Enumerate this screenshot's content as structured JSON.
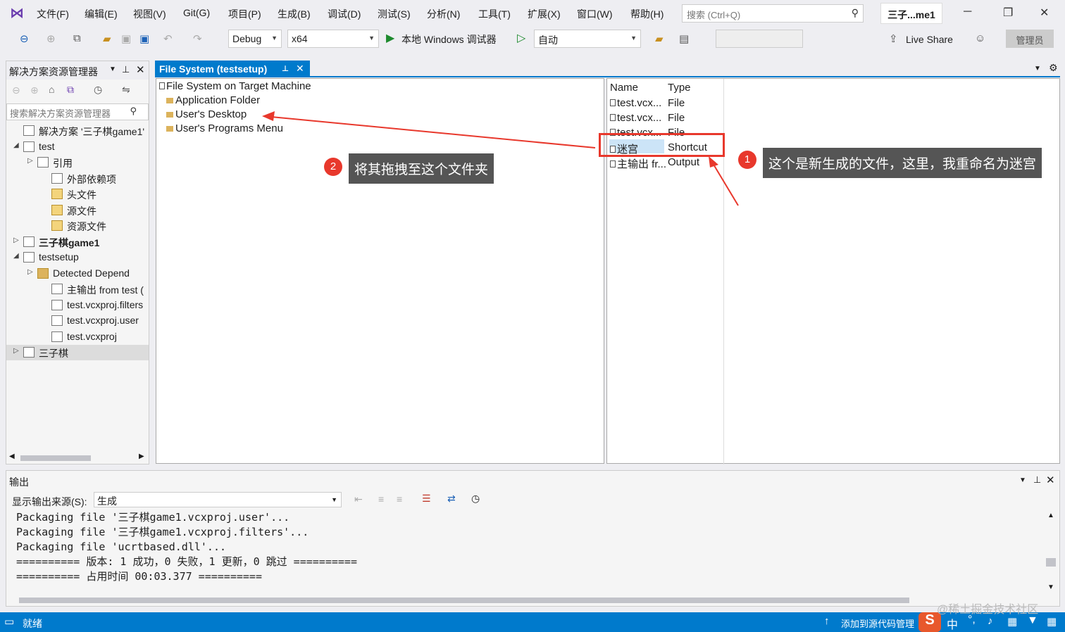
{
  "menubar": {
    "items": [
      "文件(F)",
      "编辑(E)",
      "视图(V)",
      "Git(G)",
      "项目(P)",
      "生成(B)",
      "调试(D)",
      "测试(S)",
      "分析(N)",
      "工具(T)",
      "扩展(X)",
      "窗口(W)",
      "帮助(H)"
    ],
    "search_placeholder": "搜索 (Ctrl+Q)",
    "window_title": "三子...me1"
  },
  "toolbar": {
    "config": "Debug",
    "platform": "x64",
    "debugger": "本地 Windows 调试器",
    "startup": "自动",
    "live_share": "Live Share",
    "admin": "管理员"
  },
  "solution_explorer": {
    "title": "解决方案资源管理器",
    "search_placeholder": "搜索解决方案资源管理器",
    "items": [
      {
        "label": "解决方案 '三子棋game1'",
        "icon": "solution-icon",
        "expander": ""
      },
      {
        "label": "test",
        "icon": "cpp-project-icon",
        "expander": "◢"
      },
      {
        "label": "引用",
        "icon": "references-icon",
        "expander": "▷"
      },
      {
        "label": "外部依赖项",
        "icon": "external-deps-icon",
        "expander": ""
      },
      {
        "label": "头文件",
        "icon": "filter-icon",
        "expander": ""
      },
      {
        "label": "源文件",
        "icon": "filter-icon",
        "expander": ""
      },
      {
        "label": "资源文件",
        "icon": "filter-icon",
        "expander": ""
      },
      {
        "label": "三子棋game1",
        "icon": "cpp-project-icon",
        "expander": "▷"
      },
      {
        "label": "testsetup",
        "icon": "setup-project-icon",
        "expander": "◢"
      },
      {
        "label": "Detected Depend",
        "icon": "folder-icon",
        "expander": "▷"
      },
      {
        "label": "主输出 from test (",
        "icon": "output-icon",
        "expander": ""
      },
      {
        "label": "test.vcxproj.filters",
        "icon": "file-icon",
        "expander": ""
      },
      {
        "label": "test.vcxproj.user",
        "icon": "file-icon",
        "expander": ""
      },
      {
        "label": "test.vcxproj",
        "icon": "file-icon",
        "expander": ""
      },
      {
        "label": "三子棋",
        "icon": "setup-project-icon",
        "expander": "▷"
      }
    ]
  },
  "file_system": {
    "tab_title": "File System (testsetup)",
    "tree": [
      "File System on Target Machine",
      "Application Folder",
      "User's Desktop",
      "User's Programs Menu"
    ],
    "columns": [
      "Name",
      "Type"
    ],
    "rows": [
      {
        "name": "test.vcx...",
        "type": "File"
      },
      {
        "name": "test.vcx...",
        "type": "File"
      },
      {
        "name": "test.vcx...",
        "type": "File"
      },
      {
        "name": "迷宫",
        "type": "Shortcut"
      },
      {
        "name": "主输出 fr...",
        "type": "Output"
      }
    ]
  },
  "annotations": {
    "a1_num": "1",
    "a1_text": "这个是新生成的文件，这里，我重命名为迷宫",
    "a2_num": "2",
    "a2_text": "将其拖拽至这个文件夹",
    "accent": "#e8382c"
  },
  "output": {
    "title": "输出",
    "source_label": "显示输出来源(S):",
    "source_value": "生成",
    "lines": [
      "Packaging file '三子棋game1.vcxproj.user'...",
      "Packaging file '三子棋game1.vcxproj.filters'...",
      "Packaging file 'ucrtbased.dll'...",
      "========== 版本: 1 成功，0 失败，1 更新，0 跳过 ==========",
      "========== 占用时间 00:03.377 =========="
    ]
  },
  "status": {
    "ready": "就绪",
    "source_control": "添加到源代码管理",
    "ime": "中"
  },
  "watermark": "@稀土掘金技术社区",
  "colors": {
    "accent_blue": "#007acc",
    "annotation_red": "#e8382c"
  }
}
